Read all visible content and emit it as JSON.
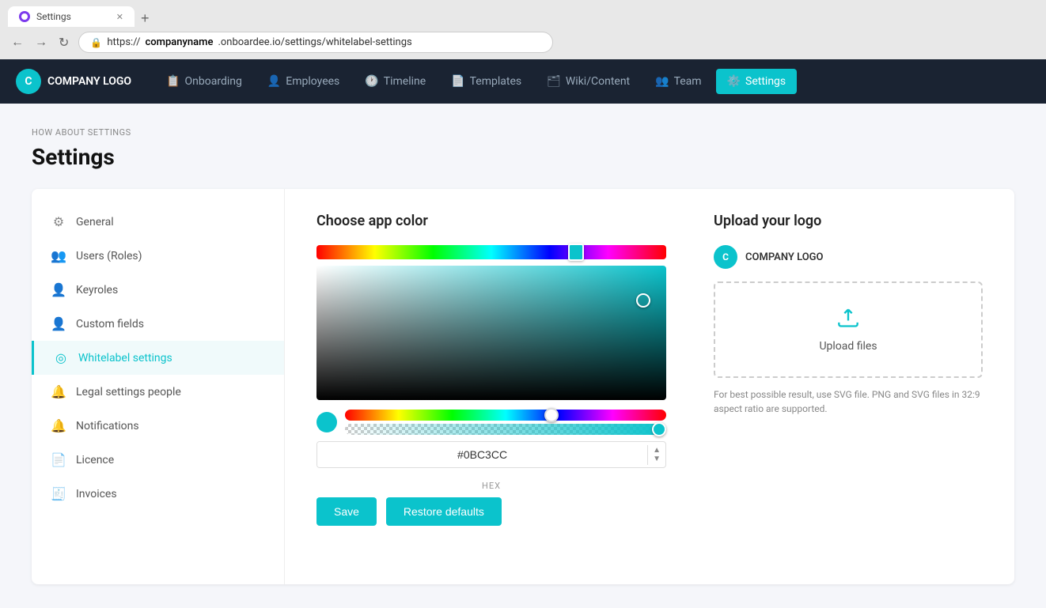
{
  "browser": {
    "tab_title": "Settings",
    "url_prefix": "https://",
    "url_highlight": "companyname",
    "url_suffix": ".onboardee.io/settings/whitelabel-settings",
    "url_full": "https://companyname.onboardee.io/settings/whitelabel-settings"
  },
  "nav": {
    "logo_text": "COMPANY LOGO",
    "logo_initial": "C",
    "items": [
      {
        "id": "onboarding",
        "label": "Onboarding",
        "icon": "📋"
      },
      {
        "id": "employees",
        "label": "Employees",
        "icon": "👤"
      },
      {
        "id": "timeline",
        "label": "Timeline",
        "icon": "🕐"
      },
      {
        "id": "templates",
        "label": "Templates",
        "icon": "📄"
      },
      {
        "id": "wiki",
        "label": "Wiki/Content",
        "icon": "🗂"
      },
      {
        "id": "team",
        "label": "Team",
        "icon": "👥"
      },
      {
        "id": "settings",
        "label": "Settings",
        "icon": "⚙️",
        "active": true
      }
    ]
  },
  "page": {
    "subtitle": "HOW ABOUT SETTINGS",
    "title": "Settings"
  },
  "sidebar": {
    "items": [
      {
        "id": "general",
        "label": "General",
        "icon": "⚙"
      },
      {
        "id": "users-roles",
        "label": "Users (Roles)",
        "icon": "👥"
      },
      {
        "id": "keyroles",
        "label": "Keyroles",
        "icon": "👤"
      },
      {
        "id": "custom-fields",
        "label": "Custom fields",
        "icon": "👤"
      },
      {
        "id": "whitelabel",
        "label": "Whitelabel settings",
        "icon": "◎",
        "active": true
      },
      {
        "id": "legal-settings",
        "label": "Legal settings people",
        "icon": "🔔"
      },
      {
        "id": "notifications",
        "label": "Notifications",
        "icon": "🔔"
      },
      {
        "id": "licence",
        "label": "Licence",
        "icon": "📄"
      },
      {
        "id": "invoices",
        "label": "Invoices",
        "icon": "🧾"
      }
    ]
  },
  "color_picker": {
    "title": "Choose app color",
    "hex_value": "#0BC3CC",
    "hex_label": "HEX"
  },
  "upload": {
    "title": "Upload your logo",
    "logo_preview_text": "COMPANY LOGO",
    "upload_label": "Upload files",
    "upload_hint": "For best possible result, use SVG file. PNG and SVG files in 32:9 aspect ratio are supported."
  },
  "buttons": {
    "save": "Save",
    "restore_defaults": "Restore defaults"
  }
}
